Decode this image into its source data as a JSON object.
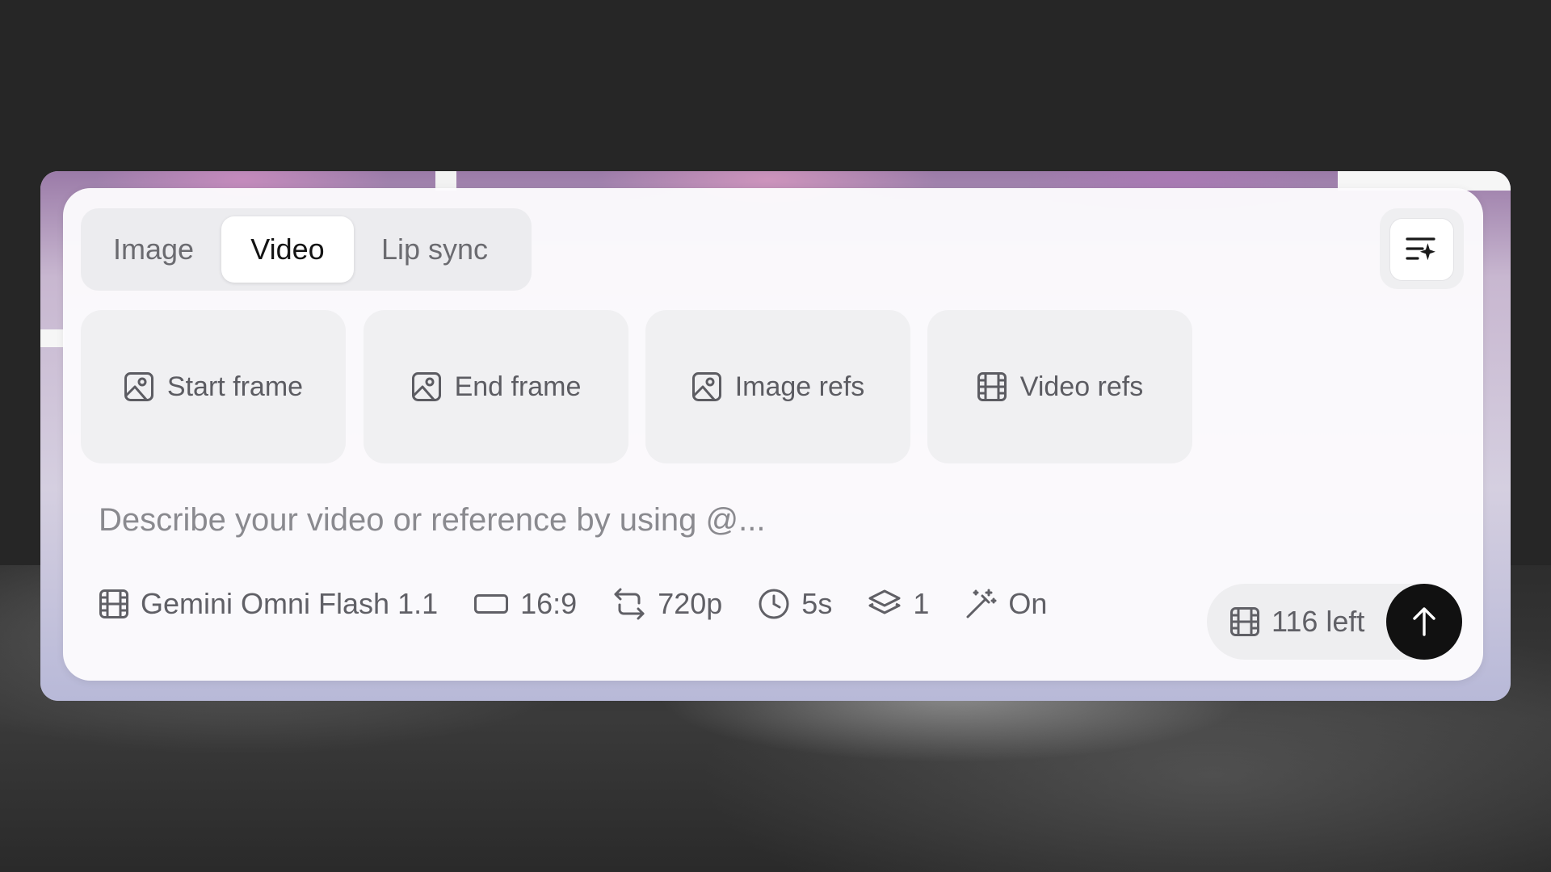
{
  "tabs": [
    {
      "label": "Image",
      "selected": false
    },
    {
      "label": "Video",
      "selected": true
    },
    {
      "label": "Lip sync",
      "selected": false
    }
  ],
  "toolbar": {
    "corner_icon": "prompt-enhance-icon"
  },
  "cards": [
    {
      "label": "Start frame",
      "icon": "image-icon"
    },
    {
      "label": "End frame",
      "icon": "image-icon"
    },
    {
      "label": "Image refs",
      "icon": "image-icon"
    },
    {
      "label": "Video refs",
      "icon": "film-icon"
    }
  ],
  "prompt": {
    "placeholder": "Describe your video or reference by using @...",
    "value": ""
  },
  "options": {
    "model": "Gemini Omni Flash 1.1",
    "aspect_ratio": "16:9",
    "resolution": "720p",
    "duration": "5s",
    "count": "1",
    "enhance": "On"
  },
  "credits": {
    "label": "116 left"
  },
  "colors": {
    "accent": "#111111",
    "background": "#262626"
  }
}
